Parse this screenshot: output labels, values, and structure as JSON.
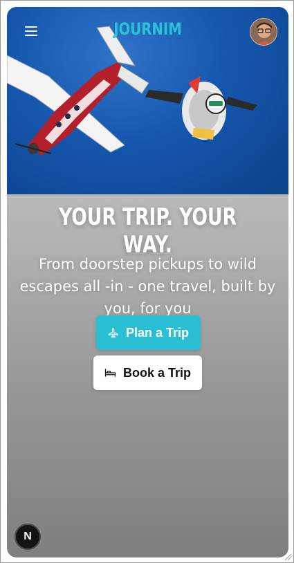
{
  "app": {
    "brand": "JOURNIM"
  },
  "header": {
    "menu_icon": "hamburger-menu-icon",
    "avatar_icon": "user-avatar"
  },
  "hero": {
    "image": "skydiver-and-airplane-photo",
    "headline": "YOUR TRIP. YOUR WAY.",
    "subheadline": "From doorstep pickups to wild escapes all -in - one travel, built by you, for you"
  },
  "actions": {
    "plan_label": "Plan a Trip",
    "plan_icon": "airplane-icon",
    "book_label": "Book a Trip",
    "book_icon": "bed-icon"
  },
  "badge": {
    "label": "N"
  },
  "colors": {
    "accent": "#2bbfd3",
    "brand_text": "#2bc4d8",
    "sky": "#1557ad"
  }
}
